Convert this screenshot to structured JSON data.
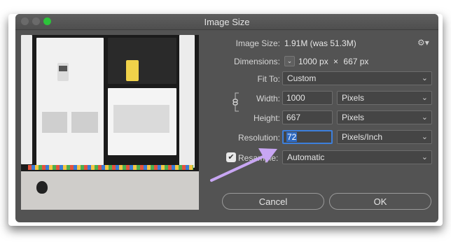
{
  "window": {
    "title": "Image Size"
  },
  "image_size": {
    "label": "Image Size:",
    "value": "1.91M (was 51.3M)"
  },
  "dimensions": {
    "label": "Dimensions:",
    "width": "1000 px",
    "times": "×",
    "height": "667 px"
  },
  "fit_to": {
    "label": "Fit To:",
    "value": "Custom"
  },
  "width": {
    "label": "Width:",
    "value": "1000",
    "unit": "Pixels"
  },
  "height": {
    "label": "Height:",
    "value": "667",
    "unit": "Pixels"
  },
  "resolution": {
    "label": "Resolution:",
    "value": "72",
    "unit": "Pixels/Inch"
  },
  "resample": {
    "label": "Resample:",
    "checked": true,
    "value": "Automatic"
  },
  "buttons": {
    "cancel": "Cancel",
    "ok": "OK"
  },
  "icons": {
    "gear": "gear-icon",
    "link": "link-icon",
    "dropdown": "chevron-down-icon",
    "check": "checkmark-icon"
  },
  "colors": {
    "dialog_bg": "#535353",
    "selection": "#2f6bc4",
    "annotation_arrow": "#c8a6f3",
    "traffic_green": "#2cc33a"
  }
}
